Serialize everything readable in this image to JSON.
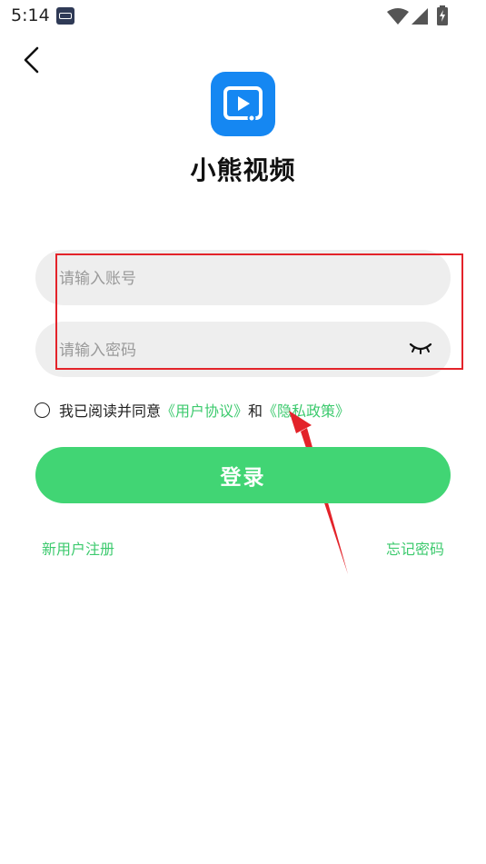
{
  "status_bar": {
    "time": "5:14",
    "icons": [
      "app-notification-icon",
      "wifi-icon",
      "signal-icon",
      "battery-charging-icon"
    ]
  },
  "header": {
    "back_icon": "chevron-left-icon"
  },
  "app": {
    "name": "小熊视频",
    "logo_icon": "video-play-icon",
    "logo_color": "#1587f2"
  },
  "form": {
    "account_placeholder": "请输入账号",
    "account_value": "",
    "password_placeholder": "请输入密码",
    "password_value": "",
    "password_toggle_icon": "eye-closed-icon"
  },
  "agreement": {
    "prefix": "我已阅读并同意",
    "user_agreement": "《用户协议》",
    "conjunction": "和",
    "privacy_policy": "《隐私政策》",
    "checked": false
  },
  "actions": {
    "login_label": "登录",
    "register_label": "新用户注册",
    "forgot_label": "忘记密码"
  },
  "colors": {
    "accent_green": "#41d574",
    "link_green": "#3dca6e",
    "annotation_red": "#e3232a",
    "field_bg": "#eeeeee"
  }
}
